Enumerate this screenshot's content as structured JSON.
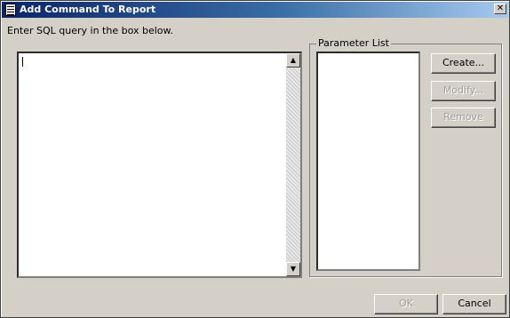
{
  "window": {
    "title": "Add Command To Report",
    "close_glyph": "✕"
  },
  "sql": {
    "label": "Enter SQL query in the box below.",
    "value": "",
    "scroll_up": "▲",
    "scroll_down": "▼"
  },
  "parameters": {
    "group_label": "Parameter List",
    "items": [],
    "create_label": "Create...",
    "modify_label": "Modify...",
    "remove_label": "Remove"
  },
  "footer": {
    "ok_label": "OK",
    "cancel_label": "Cancel"
  },
  "icons": [
    "report-icon",
    "close-icon",
    "scroll-up-arrow-icon",
    "scroll-down-arrow-icon"
  ]
}
